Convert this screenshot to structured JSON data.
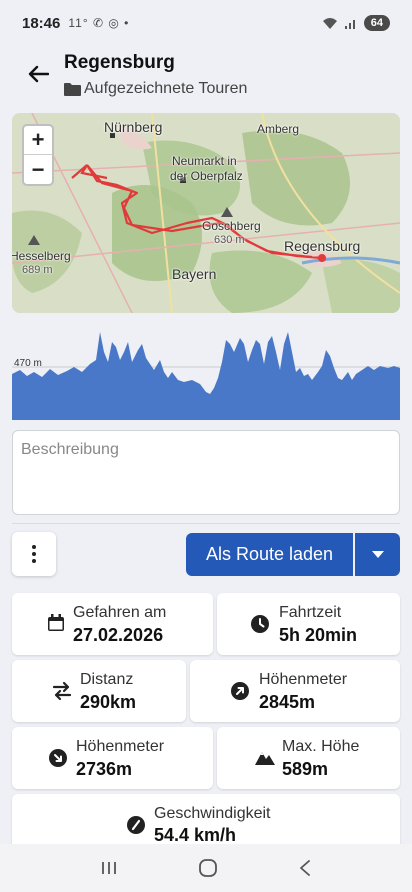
{
  "status": {
    "time": "18:46",
    "notif": "11° ✆ ◎ •",
    "battery": "64"
  },
  "header": {
    "title": "Regensburg",
    "subtitle": "Aufgezeichnete Touren"
  },
  "map": {
    "zoom_in": "+",
    "zoom_out": "−",
    "labels": {
      "nuernberg": "Nürnberg",
      "amberg": "Amberg",
      "neumarkt1": "Neumarkt in",
      "neumarkt2": "der Oberpfalz",
      "goschberg": "Goschberg",
      "goschberg_h": "630 m",
      "regensburg": "Regensburg",
      "bayern": "Bayern",
      "hesselberg": "Hesselberg",
      "hesselberg_h": "689 m"
    }
  },
  "elevation": {
    "max_label": "470 m"
  },
  "description": {
    "placeholder": "Beschreibung"
  },
  "actions": {
    "route_label": "Als Route laden"
  },
  "stats": {
    "date_label": "Gefahren am",
    "date_value": "27.02.2026",
    "time_label": "Fahrtzeit",
    "time_value": "5h 20min",
    "distance_label": "Distanz",
    "distance_value": "290km",
    "ascent_label": "Höhenmeter",
    "ascent_value": "2845m",
    "descent_label": "Höhenmeter",
    "descent_value": "2736m",
    "maxh_label": "Max. Höhe",
    "maxh_value": "589m",
    "speed_label": "Geschwindigkeit",
    "speed_value": "54.4 km/h"
  },
  "colors": {
    "accent": "#2459b8",
    "route": "#e03a3a",
    "elevation_fill": "#4a78c8"
  }
}
